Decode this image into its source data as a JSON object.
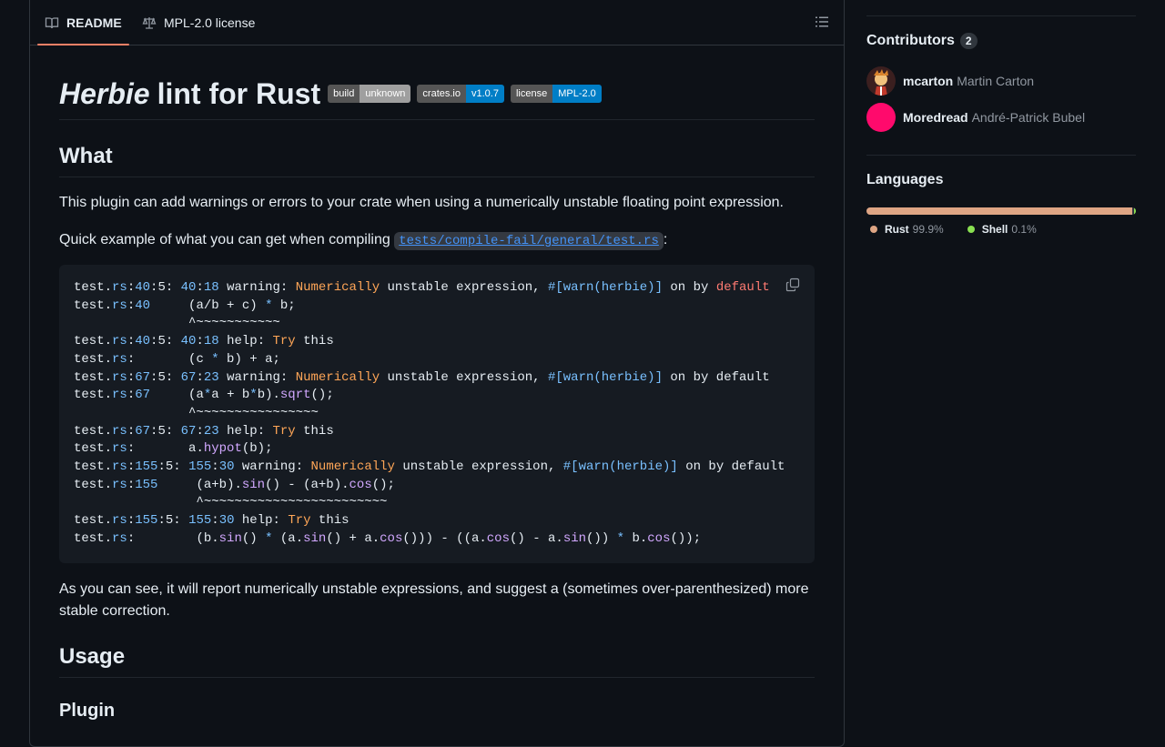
{
  "tabs": {
    "readme": "README",
    "license": "MPL-2.0 license"
  },
  "readme": {
    "title_em": "Herbie",
    "title_rest": "lint for Rust",
    "badges": [
      {
        "label": "build",
        "value": "unknown",
        "color": "#9f9f9f"
      },
      {
        "label": "crates.io",
        "value": "v1.0.7",
        "color": "#007ec6"
      },
      {
        "label": "license",
        "value": "MPL-2.0",
        "color": "#007ec6"
      }
    ],
    "what_heading": "What",
    "what_text": "This plugin can add warnings or errors to your crate when using a numerically unstable floating point expression.",
    "quick_text": "Quick example of what you can get when compiling",
    "quick_link": "tests/compile-fail/general/test.rs",
    "quick_colon": ":",
    "after_text": "As you can see, it will report numerically unstable expressions, and suggest a (sometimes over-parenthesized) more stable correction.",
    "usage_heading": "Usage",
    "plugin_heading": "Plugin"
  },
  "code_lines": [
    "test.rs:40:5: 40:18 warning: Numerically unstable expression, #[warn(herbie)] on by default",
    "test.rs:40     (a/b + c) * b;",
    "               ^~~~~~~~~~~~",
    "test.rs:40:5: 40:18 help: Try this",
    "test.rs:       (c * b) + a;",
    "test.rs:67:5: 67:23 warning: Numerically unstable expression, #[warn(herbie)] on by default",
    "test.rs:67     (a*a + b*b).sqrt();",
    "               ^~~~~~~~~~~~~~~~~",
    "test.rs:67:5: 67:23 help: Try this",
    "test.rs:       a.hypot(b);",
    "test.rs:155:5: 155:30 warning: Numerically unstable expression, #[warn(herbie)] on by default",
    "test.rs:155     (a+b).sin() - (a+b).cos();",
    "                ^~~~~~~~~~~~~~~~~~~~~~~~~",
    "test.rs:155:5: 155:30 help: Try this",
    "test.rs:        (b.sin() * (a.sin() + a.cos())) - ((a.cos() - a.sin()) * b.cos());"
  ],
  "contributors": {
    "heading": "Contributors",
    "count": "2",
    "list": [
      {
        "login": "mcarton",
        "name": "Martin Carton"
      },
      {
        "login": "Moredread",
        "name": "André-Patrick Bubel"
      }
    ]
  },
  "languages": {
    "heading": "Languages",
    "list": [
      {
        "name": "Rust",
        "percent": "99.9%",
        "color": "#dea584",
        "share": 99.9
      },
      {
        "name": "Shell",
        "percent": "0.1%",
        "color": "#89e051",
        "share": 0.1
      }
    ]
  }
}
